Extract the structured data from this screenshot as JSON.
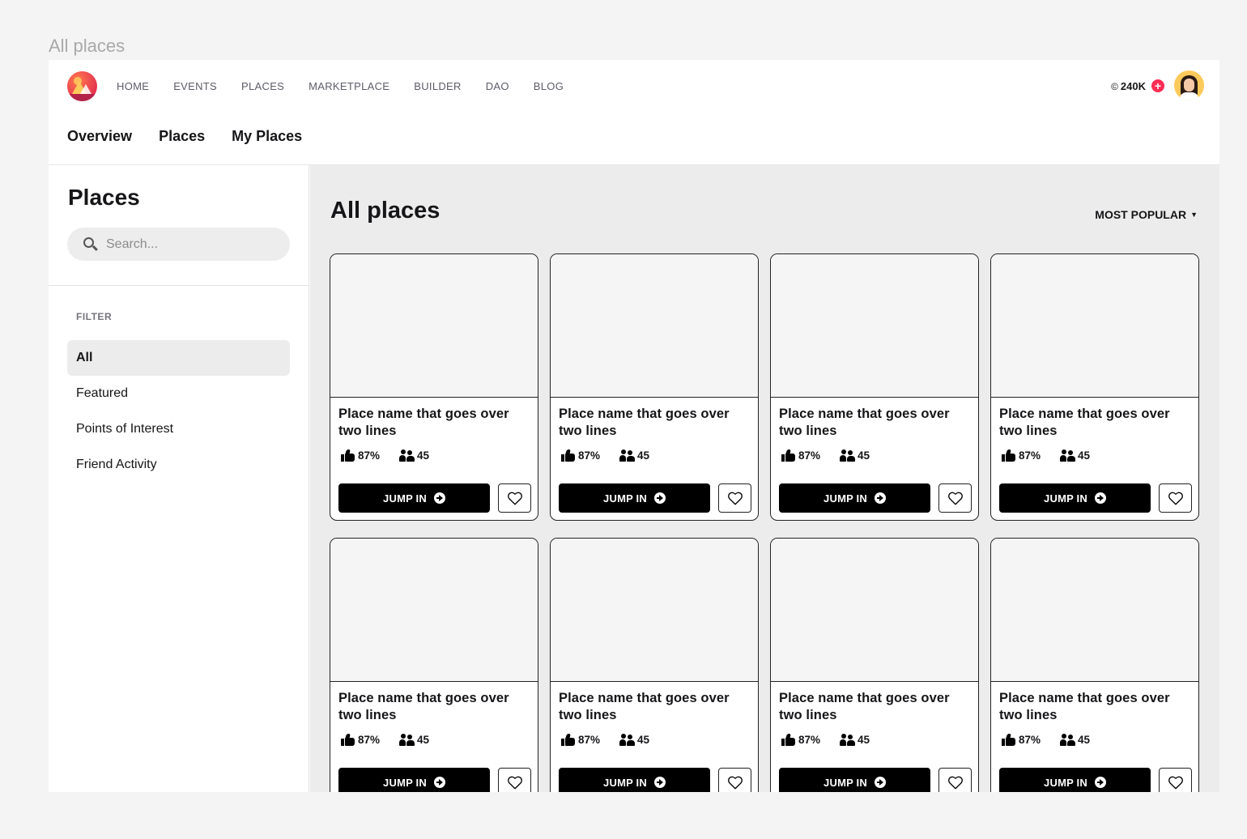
{
  "frame_label": "All places",
  "nav": {
    "items": [
      "HOME",
      "EVENTS",
      "PLACES",
      "MARKETPLACE",
      "BUILDER",
      "DAO",
      "BLOG"
    ],
    "mana_symbol": "©",
    "mana_balance": "240K",
    "add_symbol": "+"
  },
  "tabs": [
    {
      "label": "Overview",
      "active": false
    },
    {
      "label": "Places",
      "active": true
    },
    {
      "label": "My Places",
      "active": false
    }
  ],
  "sidebar": {
    "title": "Places",
    "search_placeholder": "Search...",
    "filter_label": "FILTER",
    "filters": [
      {
        "label": "All",
        "active": true
      },
      {
        "label": "Featured",
        "active": false
      },
      {
        "label": "Points of Interest",
        "active": false
      },
      {
        "label": "Friend Activity",
        "active": false
      }
    ]
  },
  "main": {
    "title": "All places",
    "sort_label": "MOST POPULAR",
    "sort_caret": "▼",
    "cards": [
      {
        "name": "Place name that goes over two lines",
        "rating": "87%",
        "users": "45",
        "cta": "JUMP IN"
      },
      {
        "name": "Place name that goes over two lines",
        "rating": "87%",
        "users": "45",
        "cta": "JUMP IN"
      },
      {
        "name": "Place name that goes over two lines",
        "rating": "87%",
        "users": "45",
        "cta": "JUMP IN"
      },
      {
        "name": "Place name that goes over two lines",
        "rating": "87%",
        "users": "45",
        "cta": "JUMP IN"
      },
      {
        "name": "Place name that goes over two lines",
        "rating": "87%",
        "users": "45",
        "cta": "JUMP IN"
      },
      {
        "name": "Place name that goes over two lines",
        "rating": "87%",
        "users": "45",
        "cta": "JUMP IN"
      },
      {
        "name": "Place name that goes over two lines",
        "rating": "87%",
        "users": "45",
        "cta": "JUMP IN"
      },
      {
        "name": "Place name that goes over two lines",
        "rating": "87%",
        "users": "45",
        "cta": "JUMP IN"
      }
    ]
  },
  "colors": {
    "accent": "#ff2d55",
    "text": "#161518",
    "muted": "#5e5b67",
    "main_bg": "#ececec"
  },
  "icons": {
    "logo": "decentraland-logo",
    "search": "search-icon",
    "rating": "thumbs-up-icon",
    "users": "users-icon",
    "jump": "arrow-right-circle-icon",
    "favorite": "heart-icon"
  }
}
